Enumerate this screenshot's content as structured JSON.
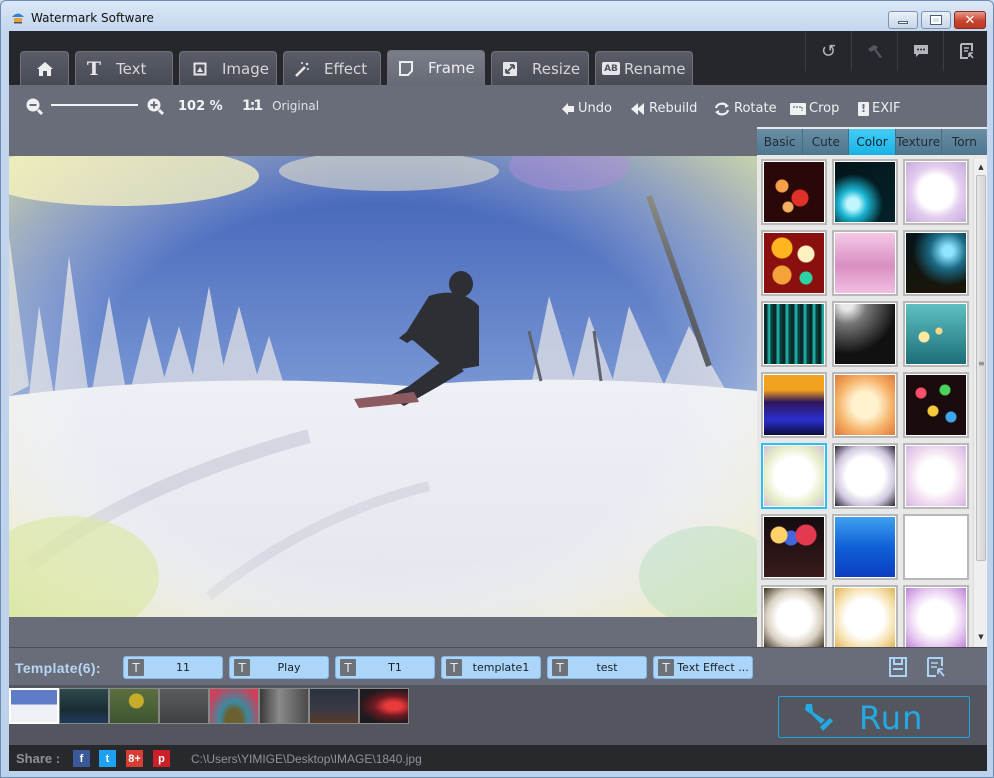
{
  "window": {
    "title": "Watermark Software",
    "controls": {
      "minimize": "minimize",
      "maximize": "maximize",
      "close": "close"
    }
  },
  "main_tabs": [
    {
      "id": "home",
      "label": "",
      "icon": "home-icon"
    },
    {
      "id": "text",
      "label": "Text",
      "icon": "text-icon"
    },
    {
      "id": "image",
      "label": "Image",
      "icon": "image-icon"
    },
    {
      "id": "effect",
      "label": "Effect",
      "icon": "magic-wand-icon"
    },
    {
      "id": "frame",
      "label": "Frame",
      "icon": "frame-icon",
      "active": true
    },
    {
      "id": "resize",
      "label": "Resize",
      "icon": "resize-icon"
    },
    {
      "id": "rename",
      "label": "Rename",
      "icon": "rename-icon"
    }
  ],
  "top_right_buttons": [
    {
      "id": "refresh",
      "icon": "refresh-icon"
    },
    {
      "id": "tools",
      "icon": "hammer-icon"
    },
    {
      "id": "feedback",
      "icon": "chat-icon"
    },
    {
      "id": "register",
      "icon": "register-icon"
    }
  ],
  "toolbar": {
    "zoom_value": "102 %",
    "zoom_level_percent": 102,
    "original_label": "Original",
    "original_icon_text": "1:1",
    "actions": [
      {
        "id": "undo",
        "label": "Undo",
        "icon": "undo-icon"
      },
      {
        "id": "rebuild",
        "label": "Rebuild",
        "icon": "rebuild-icon"
      },
      {
        "id": "rotate",
        "label": "Rotate",
        "icon": "rotate-icon"
      },
      {
        "id": "crop",
        "label": "Crop",
        "icon": "crop-icon"
      },
      {
        "id": "exif",
        "label": "EXIF",
        "icon": "exif-icon"
      }
    ]
  },
  "frame_panel": {
    "tabs": [
      {
        "label": "Basic"
      },
      {
        "label": "Cute"
      },
      {
        "label": "Color",
        "active": true
      },
      {
        "label": "Texture"
      },
      {
        "label": "Torn"
      }
    ],
    "tiles": [
      {
        "name": "red-bokeh"
      },
      {
        "name": "cyan-sparks"
      },
      {
        "name": "lavender-frame"
      },
      {
        "name": "colorful-bokeh"
      },
      {
        "name": "pink-texture"
      },
      {
        "name": "teal-light-streaks"
      },
      {
        "name": "teal-rays"
      },
      {
        "name": "light-beams"
      },
      {
        "name": "teal-rain-bokeh"
      },
      {
        "name": "blue-club-lights"
      },
      {
        "name": "golden-sparkle"
      },
      {
        "name": "dark-party-bokeh"
      },
      {
        "name": "pastel-glow",
        "selected": true
      },
      {
        "name": "white-vignette"
      },
      {
        "name": "lilac-glow"
      },
      {
        "name": "night-bokeh"
      },
      {
        "name": "underwater-blue"
      },
      {
        "name": "gold-oval"
      },
      {
        "name": "gold-bokeh-glow"
      },
      {
        "name": "warm-glow"
      },
      {
        "name": "purple-glow"
      }
    ]
  },
  "templates": {
    "label": "Template(6):",
    "items": [
      {
        "name": "11"
      },
      {
        "name": "Play"
      },
      {
        "name": "T1"
      },
      {
        "name": "template1"
      },
      {
        "name": "test"
      },
      {
        "name": "Text Effect ..."
      }
    ],
    "type_icon_text": "T"
  },
  "filmstrip": [
    {
      "name": "snowboard",
      "selected": true
    },
    {
      "name": "night-rock"
    },
    {
      "name": "leaf-branch"
    },
    {
      "name": "foggy-forest"
    },
    {
      "name": "balloon"
    },
    {
      "name": "waterfall"
    },
    {
      "name": "desert-night"
    },
    {
      "name": "red-light"
    }
  ],
  "run_button": {
    "label": "Run"
  },
  "status": {
    "share_label": "Share :",
    "social": [
      {
        "id": "facebook",
        "glyph": "f",
        "color": "#3b5998"
      },
      {
        "id": "twitter",
        "glyph": "t",
        "color": "#1da1f2"
      },
      {
        "id": "google-plus",
        "glyph": "8+",
        "color": "#d73d32"
      },
      {
        "id": "pinterest",
        "glyph": "p",
        "color": "#cb2027"
      }
    ],
    "file_path": "C:\\Users\\YIMIGE\\Desktop\\IMAGE\\1840.jpg"
  }
}
